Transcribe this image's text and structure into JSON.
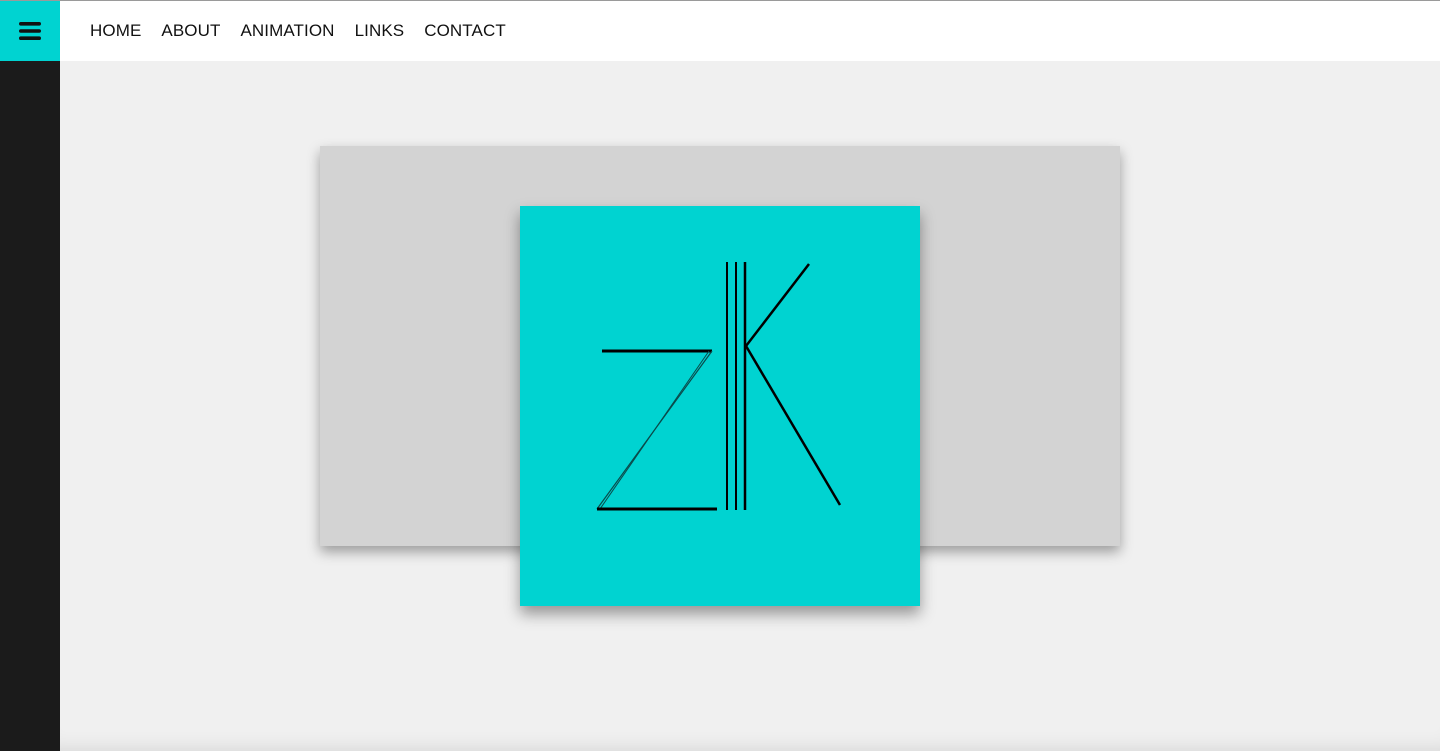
{
  "nav": {
    "items": [
      {
        "label": "HOME"
      },
      {
        "label": "ABOUT"
      },
      {
        "label": "ANIMATION"
      },
      {
        "label": "LINKS"
      },
      {
        "label": "CONTACT"
      }
    ]
  },
  "menu_button": {
    "icon": "hamburger-menu-icon"
  },
  "logo": {
    "alt": "zK",
    "icon": "zk-monogram-logo"
  },
  "colors": {
    "accent": "#00d3d1",
    "sidebar": "#1b1b1b",
    "topbar": "#ffffff",
    "background": "#f0f0f0",
    "card": "#d3d3d3",
    "text": "#111111",
    "logo_stroke": "#000000"
  }
}
